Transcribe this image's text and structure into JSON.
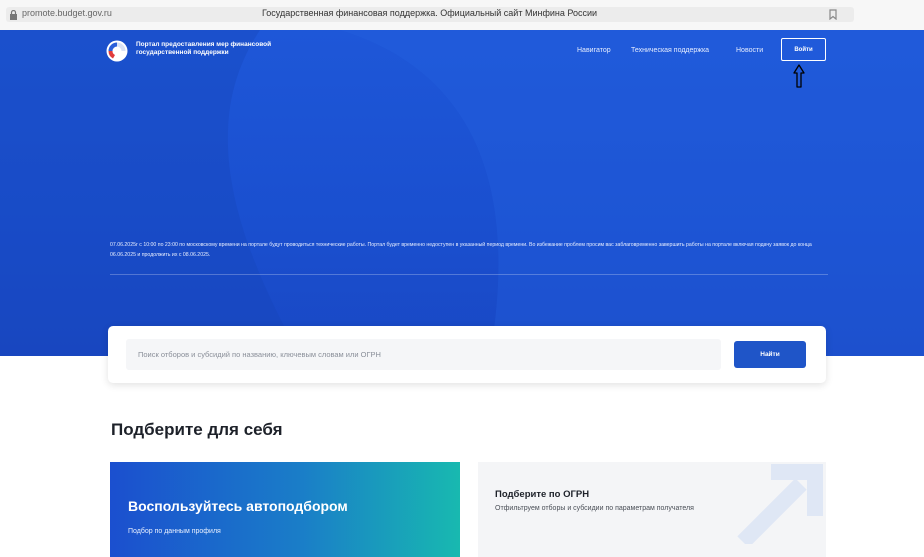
{
  "browser": {
    "url": "promote.budget.gov.ru",
    "tab_title": "Государственная финансовая поддержка. Официальный сайт Минфина России"
  },
  "header": {
    "logo_text": "Портал предоставления мер финансовой государственной поддержки",
    "nav": [
      "Навигатор",
      "Техническая поддержка",
      "Новости"
    ],
    "login_label": "Войти"
  },
  "notice": {
    "text": "07.06.2025г с 10:00 по 23:00 по московскому времени на портале будут проводиться технические работы. Портал будет временно недоступен в указанный период времени. Во избежание проблем просим вас заблаговременно завершить работы на портале включая подачу заявок до конца 06.06.2025 и продолжить их с 08.06.2025."
  },
  "search": {
    "placeholder": "Поиск отборов и субсидий по названию, ключевым словам или ОГРН",
    "button_label": "Найти"
  },
  "section": {
    "title": "Подберите для себя"
  },
  "cards": {
    "auto": {
      "title": "Воспользуйтесь автоподбором",
      "subtitle": "Подбор по данным профиля"
    },
    "ogrn": {
      "title": "Подберите по ОГРН",
      "subtitle": "Отфильтруем отборы и субсидии по параметрам получателя"
    }
  },
  "colors": {
    "hero_blue": "#1e57d8",
    "button_blue": "#1f55c8",
    "gradient_teal": "#18b9b0"
  },
  "icons": [
    "lock-icon",
    "bookmark-icon",
    "portal-logo",
    "arrow-up-icon",
    "diagonal-arrow-icon"
  ]
}
